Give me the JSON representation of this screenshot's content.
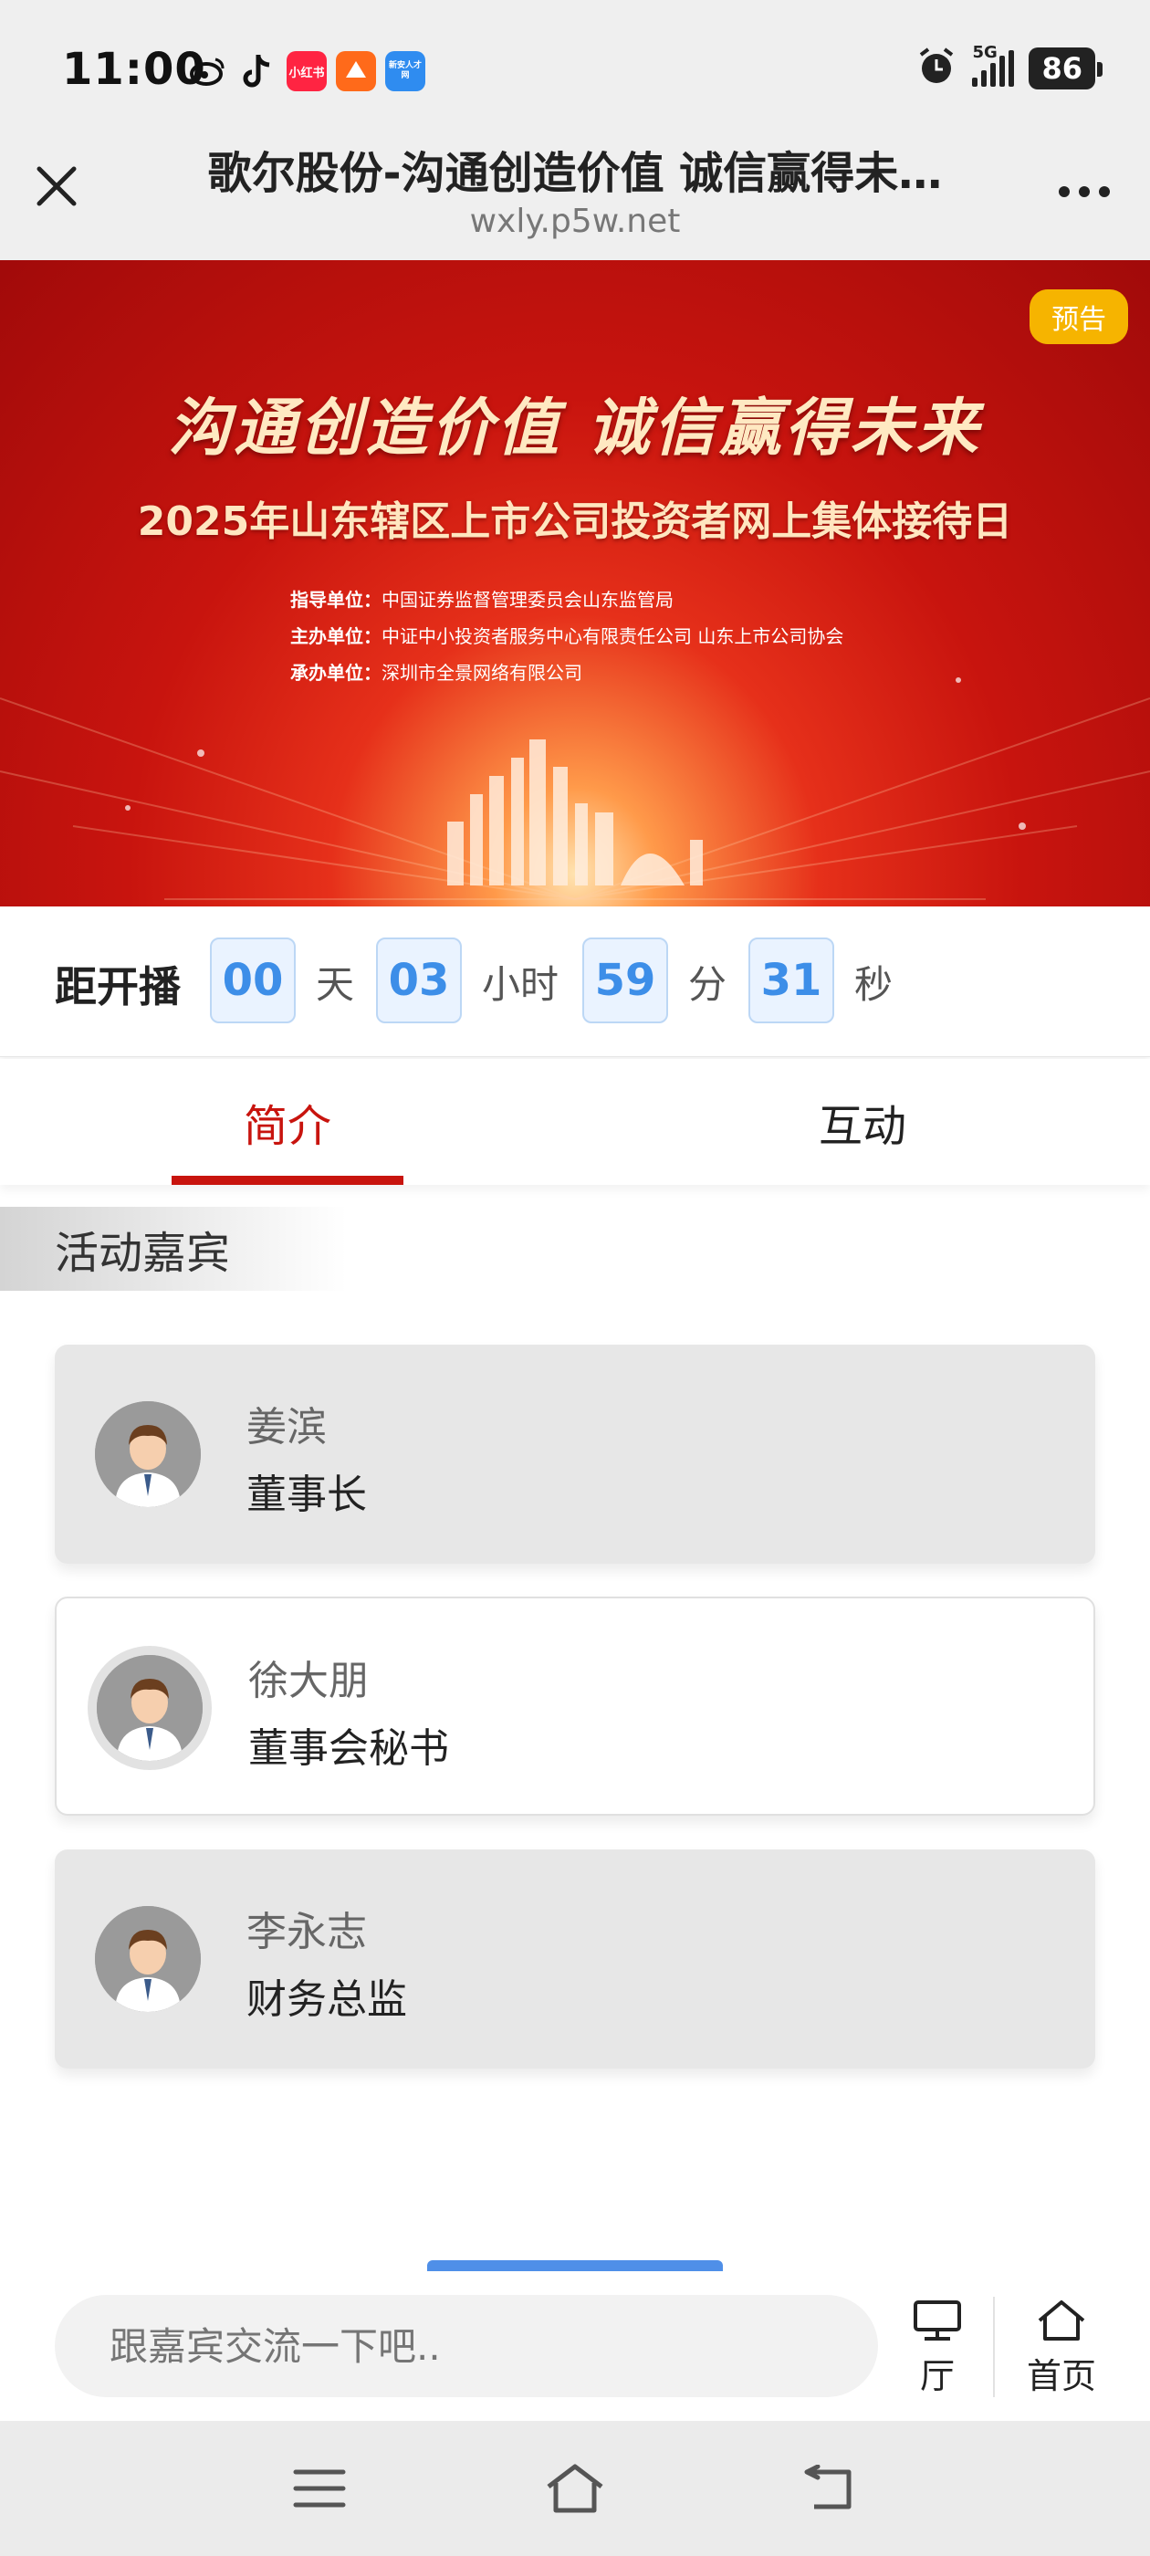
{
  "status_bar": {
    "time": "11:00",
    "network": "5G",
    "battery": "86",
    "apps": [
      {
        "name": "weibo-icon",
        "color": "#ffffff"
      },
      {
        "name": "tiktok-icon",
        "color": "#ffffff"
      },
      {
        "name": "xiaohongshu-icon",
        "label": "小红书",
        "color": "#ff2442"
      },
      {
        "name": "app-orange-icon",
        "color": "#ff6a1a"
      },
      {
        "name": "app-blue-icon",
        "label": "新安人才网",
        "color": "#2f8cf0"
      }
    ]
  },
  "title_bar": {
    "title": "歌尔股份-沟通创造价值 诚信赢得未…",
    "url": "wxly.p5w.net"
  },
  "banner": {
    "badge": "预告",
    "slogan": "沟通创造价值  诚信赢得未来",
    "title": "2025年山东辖区上市公司投资者网上集体接待日",
    "orgs": [
      {
        "label": "指导单位：",
        "value": "中国证券监督管理委员会山东监管局"
      },
      {
        "label": "主办单位：",
        "value": "中证中小投资者服务中心有限责任公司  山东上市公司协会"
      },
      {
        "label": "承办单位：",
        "value": "深圳市全景网络有限公司"
      }
    ]
  },
  "countdown": {
    "label": "距开播",
    "days": "00",
    "days_unit": "天",
    "hours": "03",
    "hours_unit": "小时",
    "minutes": "59",
    "minutes_unit": "分",
    "seconds": "31",
    "seconds_unit": "秒"
  },
  "tabs": [
    {
      "label": "简介",
      "active": true
    },
    {
      "label": "互动",
      "active": false
    }
  ],
  "section": {
    "title": "活动嘉宾"
  },
  "guests": [
    {
      "name": "姜滨",
      "role": "董事长"
    },
    {
      "name": "徐大朋",
      "role": "董事会秘书"
    },
    {
      "name": "李永志",
      "role": "财务总监"
    }
  ],
  "input_bar": {
    "placeholder": "跟嘉宾交流一下吧..",
    "hall_label": "厅",
    "home_label": "首页"
  },
  "colors": {
    "accent_red": "#c8140e",
    "countdown_blue": "#3d8ee8",
    "badge_yellow": "#f6b400"
  }
}
